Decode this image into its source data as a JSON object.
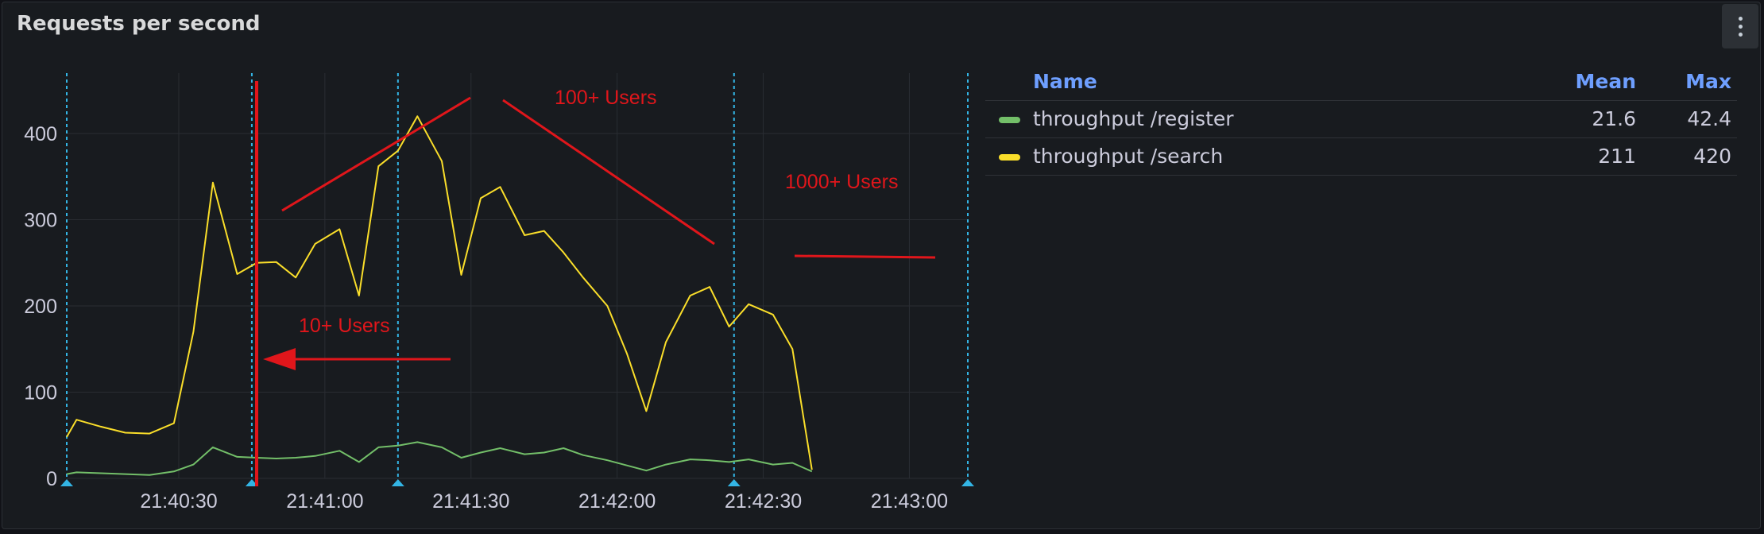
{
  "panel": {
    "title": "Requests per second"
  },
  "legend": {
    "headers": {
      "name": "Name",
      "mean": "Mean",
      "max": "Max"
    },
    "rows": [
      {
        "name": "throughput /register",
        "mean": "21.6",
        "max": "42.4",
        "color": "#73bf69"
      },
      {
        "name": "throughput /search",
        "mean": "211",
        "max": "420",
        "color": "#fade2a"
      }
    ]
  },
  "annotations": {
    "users_10": "10+ Users",
    "users_100": "100+ Users",
    "users_1000": "1000+ Users",
    "color": "#e0161b"
  },
  "chart_data": {
    "type": "line",
    "x_start": "21:40:07",
    "x_end": "21:43:12",
    "xlim": [
      "21:40:07",
      "21:43:12"
    ],
    "ylim": [
      0,
      460
    ],
    "grid": true,
    "legend_position": "right",
    "yticks": [
      0,
      100,
      200,
      300,
      400
    ],
    "xticks": [
      "21:40:30",
      "21:41:00",
      "21:41:30",
      "21:42:00",
      "21:42:30",
      "21:43:00"
    ],
    "event_markers": [
      "21:40:07",
      "21:40:45",
      "21:41:15",
      "21:42:24",
      "21:43:12"
    ],
    "series": [
      {
        "name": "throughput /search",
        "color": "#fade2a",
        "points": [
          [
            "21:40:07",
            48
          ],
          [
            "21:40:09",
            68
          ],
          [
            "21:40:14",
            60
          ],
          [
            "21:40:19",
            53
          ],
          [
            "21:40:24",
            52
          ],
          [
            "21:40:29",
            64
          ],
          [
            "21:40:33",
            170
          ],
          [
            "21:40:37",
            343
          ],
          [
            "21:40:42",
            237
          ],
          [
            "21:40:46",
            250
          ],
          [
            "21:40:50",
            251
          ],
          [
            "21:40:54",
            233
          ],
          [
            "21:40:58",
            272
          ],
          [
            "21:41:03",
            289
          ],
          [
            "21:41:07",
            212
          ],
          [
            "21:41:11",
            362
          ],
          [
            "21:41:15",
            380
          ],
          [
            "21:41:19",
            420
          ],
          [
            "21:41:24",
            368
          ],
          [
            "21:41:28",
            236
          ],
          [
            "21:41:32",
            325
          ],
          [
            "21:41:36",
            338
          ],
          [
            "21:41:41",
            282
          ],
          [
            "21:41:45",
            287
          ],
          [
            "21:41:49",
            262
          ],
          [
            "21:41:53",
            233
          ],
          [
            "21:41:58",
            200
          ],
          [
            "21:42:02",
            145
          ],
          [
            "21:42:06",
            78
          ],
          [
            "21:42:10",
            158
          ],
          [
            "21:42:15",
            212
          ],
          [
            "21:42:19",
            222
          ],
          [
            "21:42:23",
            176
          ],
          [
            "21:42:27",
            202
          ],
          [
            "21:42:32",
            190
          ],
          [
            "21:42:36",
            150
          ],
          [
            "21:42:40",
            10
          ]
        ]
      },
      {
        "name": "throughput /register",
        "color": "#73bf69",
        "points": [
          [
            "21:40:07",
            5
          ],
          [
            "21:40:09",
            7
          ],
          [
            "21:40:14",
            6
          ],
          [
            "21:40:19",
            5
          ],
          [
            "21:40:24",
            4
          ],
          [
            "21:40:29",
            8
          ],
          [
            "21:40:33",
            16
          ],
          [
            "21:40:37",
            36
          ],
          [
            "21:40:42",
            25
          ],
          [
            "21:40:46",
            24
          ],
          [
            "21:40:50",
            23
          ],
          [
            "21:40:54",
            24
          ],
          [
            "21:40:58",
            26
          ],
          [
            "21:41:03",
            32
          ],
          [
            "21:41:07",
            19
          ],
          [
            "21:41:11",
            36
          ],
          [
            "21:41:15",
            38
          ],
          [
            "21:41:19",
            42
          ],
          [
            "21:41:24",
            36
          ],
          [
            "21:41:28",
            24
          ],
          [
            "21:41:32",
            30
          ],
          [
            "21:41:36",
            35
          ],
          [
            "21:41:41",
            28
          ],
          [
            "21:41:45",
            30
          ],
          [
            "21:41:49",
            35
          ],
          [
            "21:41:53",
            27
          ],
          [
            "21:41:58",
            21
          ],
          [
            "21:42:02",
            15
          ],
          [
            "21:42:06",
            9
          ],
          [
            "21:42:10",
            16
          ],
          [
            "21:42:15",
            22
          ],
          [
            "21:42:19",
            21
          ],
          [
            "21:42:23",
            19
          ],
          [
            "21:42:27",
            22
          ],
          [
            "21:42:32",
            16
          ],
          [
            "21:42:36",
            18
          ],
          [
            "21:42:40",
            8
          ]
        ]
      }
    ]
  }
}
